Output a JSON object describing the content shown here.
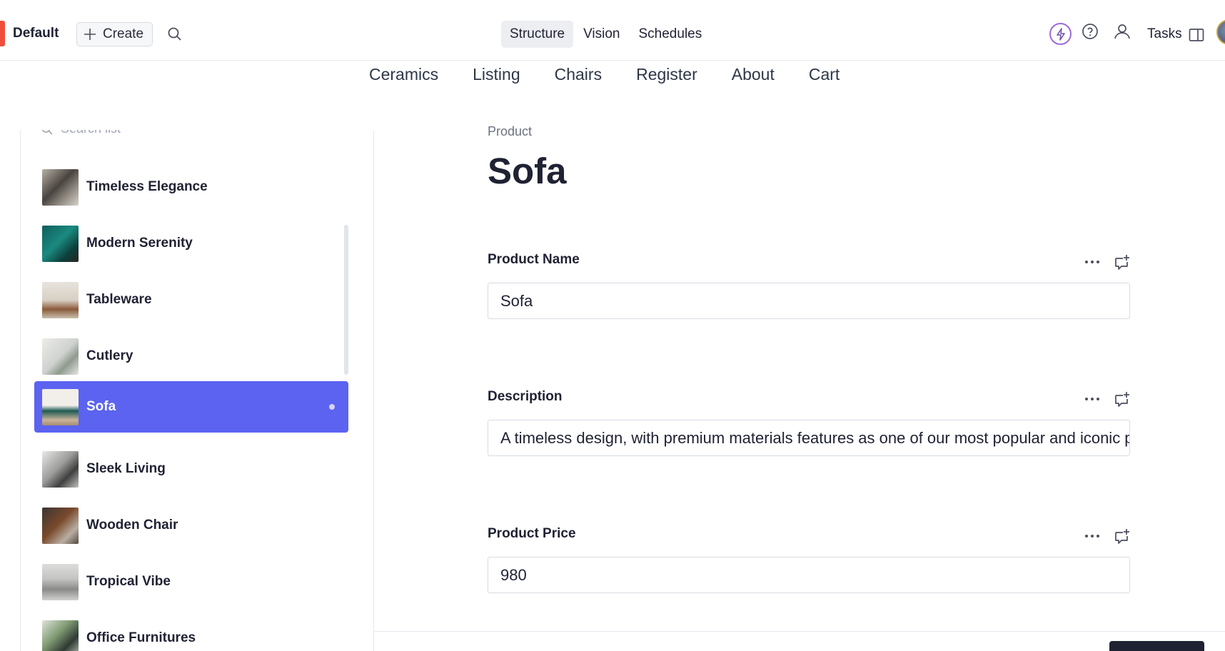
{
  "toolbar": {
    "workspace_name": "Default",
    "create_label": "Create",
    "nav_tabs": [
      {
        "label": "Structure",
        "active": true
      },
      {
        "label": "Vision",
        "active": false
      },
      {
        "label": "Schedules",
        "active": false
      }
    ],
    "tasks_label": "Tasks",
    "icons": {
      "search": "search-icon",
      "bolt": "lightning-icon",
      "help": "help-circle-icon",
      "users": "users-icon",
      "panel": "split-panel-icon"
    },
    "accent_color": "#9b6cdb",
    "workspace_color": "#ef4f3b"
  },
  "site_nav": [
    "Ceramics",
    "Listing",
    "Chairs",
    "Register",
    "About",
    "Cart"
  ],
  "list": {
    "search_placeholder": "Search list",
    "items": [
      {
        "label": "Timeless Elegance",
        "selected": false
      },
      {
        "label": "Modern Serenity",
        "selected": false
      },
      {
        "label": "Tableware",
        "selected": false
      },
      {
        "label": "Cutlery",
        "selected": false
      },
      {
        "label": "Sofa",
        "selected": true
      },
      {
        "label": "Sleek Living",
        "selected": false
      },
      {
        "label": "Wooden Chair",
        "selected": false
      },
      {
        "label": "Tropical Vibe",
        "selected": false
      },
      {
        "label": "Office Furnitures",
        "selected": false
      }
    ],
    "selected_color": "#5b63f0"
  },
  "main": {
    "breadcrumb": "Product",
    "title": "Sofa",
    "fields": [
      {
        "label": "Product Name",
        "value": "Sofa"
      },
      {
        "label": "Description",
        "value": "A timeless design, with premium materials features as one of our most popular and iconic pieces."
      },
      {
        "label": "Product Price",
        "value": "980"
      }
    ]
  }
}
